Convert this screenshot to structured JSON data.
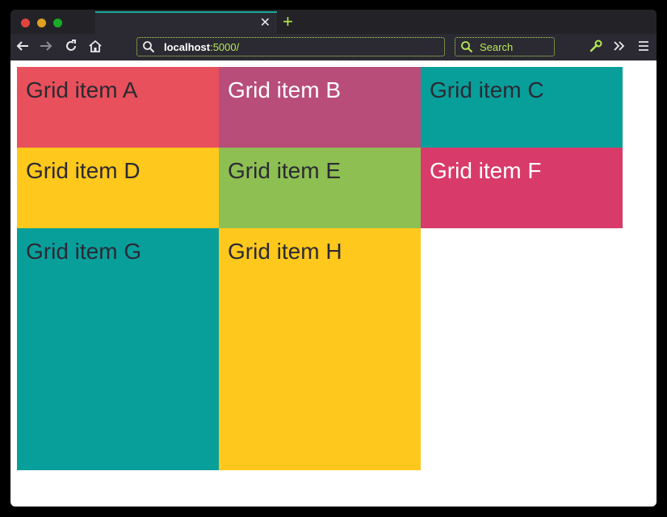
{
  "browser": {
    "tab": {
      "close_label": "✕"
    },
    "new_tab_label": "+",
    "url": {
      "host": "localhost",
      "path": ":5000/"
    },
    "search": {
      "placeholder": "Search"
    },
    "colors": {
      "accent": "#b5e853",
      "tab_indicator": "#19a89a",
      "chrome": "#2b2a33",
      "close_dot": "#e0443e",
      "minimize_dot": "#dea123",
      "zoom_dot": "#1aab29"
    },
    "icons": [
      "back-arrow-icon",
      "forward-arrow-icon",
      "reload-icon",
      "home-icon",
      "search-icon",
      "wrench-icon",
      "overflow-chevrons-icon",
      "menu-icon"
    ]
  },
  "grid": {
    "items": [
      {
        "label": "Grid item A",
        "bg": "#e8505b",
        "color": "#2b2a33"
      },
      {
        "label": "Grid item B",
        "bg": "#b84d7a",
        "color": "#ffffff"
      },
      {
        "label": "Grid item C",
        "bg": "#089f9b",
        "color": "#2b2a33"
      },
      {
        "label": "Grid item D",
        "bg": "#ffc81c",
        "color": "#2b2a33"
      },
      {
        "label": "Grid item E",
        "bg": "#8ebf52",
        "color": "#2b2a33"
      },
      {
        "label": "Grid item F",
        "bg": "#d83a6a",
        "color": "#ffffff"
      },
      {
        "label": "Grid item G",
        "bg": "#089f9b",
        "color": "#2b2a33"
      },
      {
        "label": "Grid item H",
        "bg": "#ffc81c",
        "color": "#2b2a33"
      }
    ]
  }
}
